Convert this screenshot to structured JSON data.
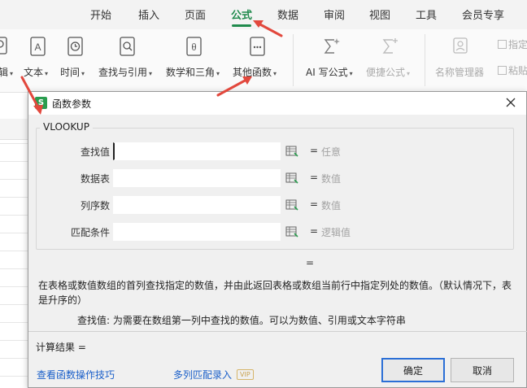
{
  "ribbon_tabs": [
    {
      "label": "开始"
    },
    {
      "label": "插入"
    },
    {
      "label": "页面"
    },
    {
      "label": "公式",
      "active": true
    },
    {
      "label": "数据"
    },
    {
      "label": "审阅"
    },
    {
      "label": "视图"
    },
    {
      "label": "工具"
    },
    {
      "label": "会员专享"
    }
  ],
  "ribbon": {
    "partial_left_label": "辑",
    "buttons": [
      {
        "label": "文本",
        "icon": "text-function-icon"
      },
      {
        "label": "时间",
        "icon": "clock-function-icon"
      },
      {
        "label": "查找与引用",
        "icon": "lookup-function-icon"
      },
      {
        "label": "数学和三角",
        "icon": "math-function-icon"
      },
      {
        "label": "其他函数",
        "icon": "more-functions-icon"
      },
      {
        "label": "AI 写公式",
        "icon": "ai-formula-icon"
      },
      {
        "label": "便捷公式",
        "icon": "quick-formula-icon"
      },
      {
        "label": "名称管理器",
        "icon": "name-manager-icon"
      },
      {
        "label": "指定",
        "icon": "define-name-icon"
      },
      {
        "label": "粘贴",
        "icon": "paste-name-icon"
      }
    ]
  },
  "dialog": {
    "title": "函数参数",
    "function_name": "VLOOKUP",
    "args": [
      {
        "label": "查找值",
        "value": "",
        "hint": "任意"
      },
      {
        "label": "数据表",
        "value": "",
        "hint": "数值"
      },
      {
        "label": "列序数",
        "value": "",
        "hint": "数值"
      },
      {
        "label": "匹配条件",
        "value": "",
        "hint": "逻辑值"
      }
    ],
    "result_eq": "=",
    "eq_sign": "=",
    "description": "在表格或数值数组的首列查找指定的数值，并由此返回表格或数组当前行中指定列处的数值。（默认情况下，表是升序的）",
    "arg_description": "查找值:  为需要在数组第一列中查找的数值。可以为数值、引用或文本字符串",
    "calc_result": "计算结果  =",
    "link_tips": "查看函数操作技巧",
    "link_multi": "多列匹配录入",
    "vip_badge": "VIP",
    "ok_label": "确定",
    "cancel_label": "取消"
  },
  "colors": {
    "accent": "#1f8a4c",
    "link": "#1a5fc9",
    "arrow": "#e2483d",
    "primary_border": "#2b6fd6"
  }
}
